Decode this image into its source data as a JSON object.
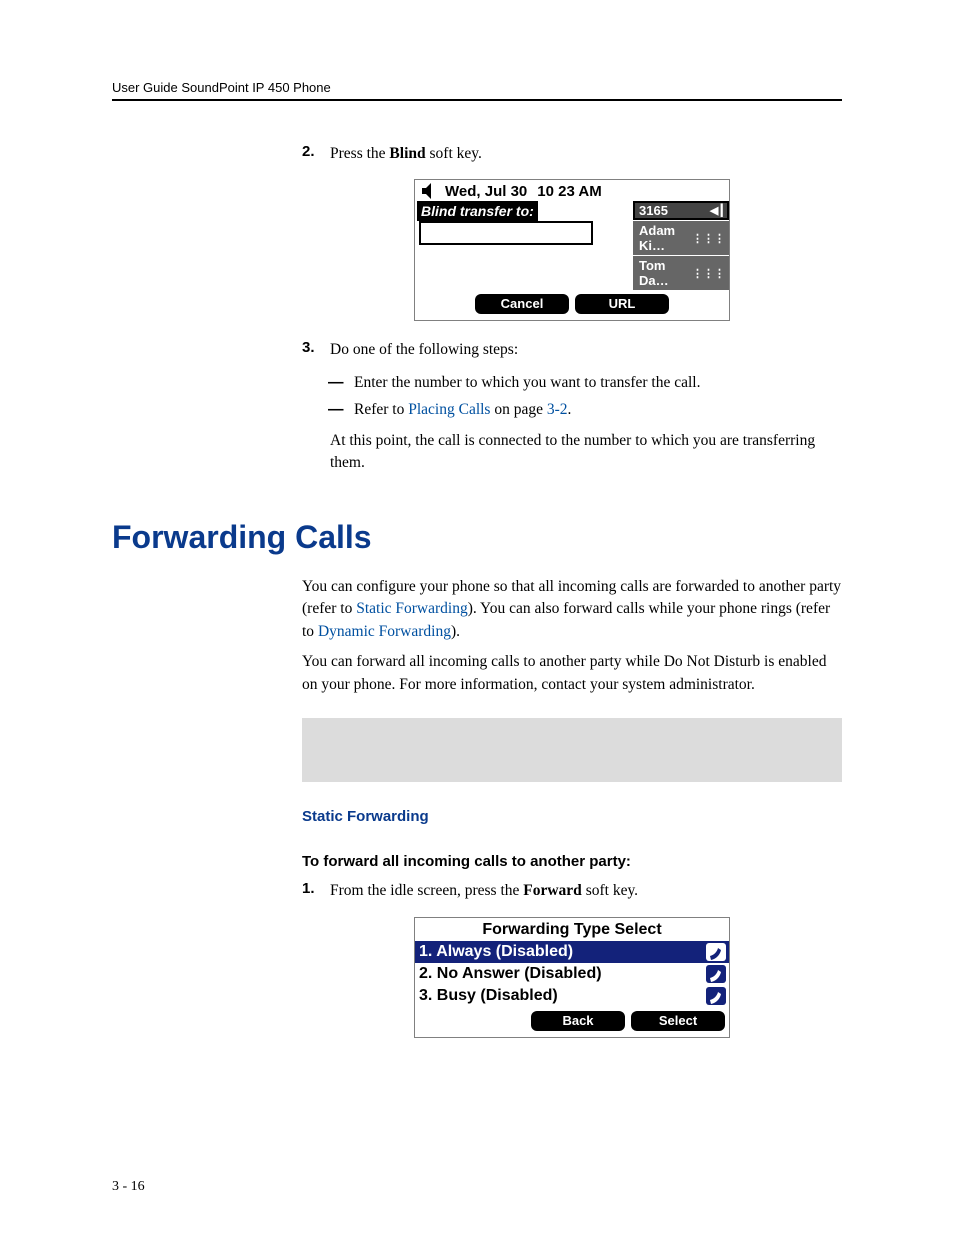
{
  "header": {
    "running": "User Guide SoundPoint IP 450 Phone"
  },
  "step2": {
    "num": "2.",
    "text_pre": "Press the ",
    "bold": "Blind",
    "text_post": " soft key."
  },
  "phone1": {
    "date": "Wed, Jul 30",
    "time": "10 23 AM",
    "label": "Blind transfer to:",
    "line1": "3165",
    "line2": "Adam Ki…",
    "line3": "Tom Da…",
    "soft1": "Cancel",
    "soft2": "URL"
  },
  "step3": {
    "num": "3.",
    "lead": "Do one of the following steps:",
    "dash1": "Enter the number to which you want to transfer the call.",
    "dash2_pre": "Refer to ",
    "dash2_link1": "Placing Calls",
    "dash2_mid": " on page ",
    "dash2_link2": "3-2",
    "dash2_post": ".",
    "after": "At this point, the call is connected to the number to which you are transferring them."
  },
  "section": {
    "title": "Forwarding Calls",
    "p1_a": "You can configure your phone so that all incoming calls are forwarded to another party (refer to ",
    "p1_link1": "Static Forwarding",
    "p1_b": "). You can also forward calls while your phone rings (refer to ",
    "p1_link2": "Dynamic Forwarding",
    "p1_c": ").",
    "p2": "You can forward all incoming calls to another party while Do Not Disturb is enabled on your phone. For more information, contact your system administrator."
  },
  "sub": {
    "heading": "Static Forwarding",
    "proc": "To forward all incoming calls to another party:",
    "s1_num": "1.",
    "s1_pre": "From the idle screen, press the ",
    "s1_bold": "Forward",
    "s1_post": " soft key."
  },
  "phone2": {
    "title": "Forwarding Type Select",
    "row1": "1. Always (Disabled)",
    "row2": "2. No Answer (Disabled)",
    "row3": "3. Busy (Disabled)",
    "soft1": "Back",
    "soft2": "Select"
  },
  "footer": {
    "page": "3 - 16"
  }
}
